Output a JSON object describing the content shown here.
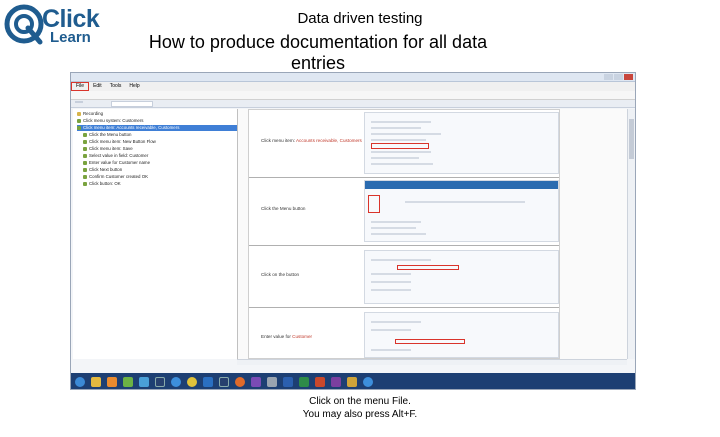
{
  "logo": {
    "word1": "Click",
    "word2": "Learn",
    "brand_color": "#1f5c8f"
  },
  "slide": {
    "title": "Data driven testing",
    "subtitle": "How to produce documentation for all data entries",
    "caption_line1": "Click on the menu File.",
    "caption_line2": "You may also press Alt+F."
  },
  "app": {
    "menu": [
      "File",
      "Edit",
      "Tools",
      "Help"
    ],
    "tree_items": [
      "Recording",
      "Click menu system: Customers",
      "Click menu item: Accounts receivable, Customers",
      "Click the Menu button",
      "Click menu item: New Button Flow",
      "Click menu item: Save",
      "Select value in field: Customer",
      "Enter value for Customer name",
      "Click Next button",
      "Confirm Customer created OK",
      "Click button: OK"
    ],
    "steps": [
      {
        "label_text": "Click menu item: ",
        "label_highlight": "Accounts receivable, Customers"
      },
      {
        "label_text": "Click the Menu button",
        "label_highlight": ""
      },
      {
        "label_text": "Click on the button",
        "label_highlight": ""
      },
      {
        "label_text": "Enter value for ",
        "label_highlight": "Customer"
      }
    ],
    "accent_color": "#d9342b",
    "selection_color": "#3f7fd6"
  },
  "taskbar": {
    "icons": [
      "start-icon",
      "folder-icon",
      "media-icon",
      "chart-icon",
      "bars-icon",
      "app-icon",
      "ie-icon",
      "chrome-icon",
      "outlook-icon",
      "app2-icon",
      "firefox-icon",
      "vs-icon",
      "settings-icon",
      "word-icon",
      "excel-icon",
      "ppt-icon",
      "onenote-icon",
      "explorer-icon",
      "ie2-icon"
    ]
  }
}
